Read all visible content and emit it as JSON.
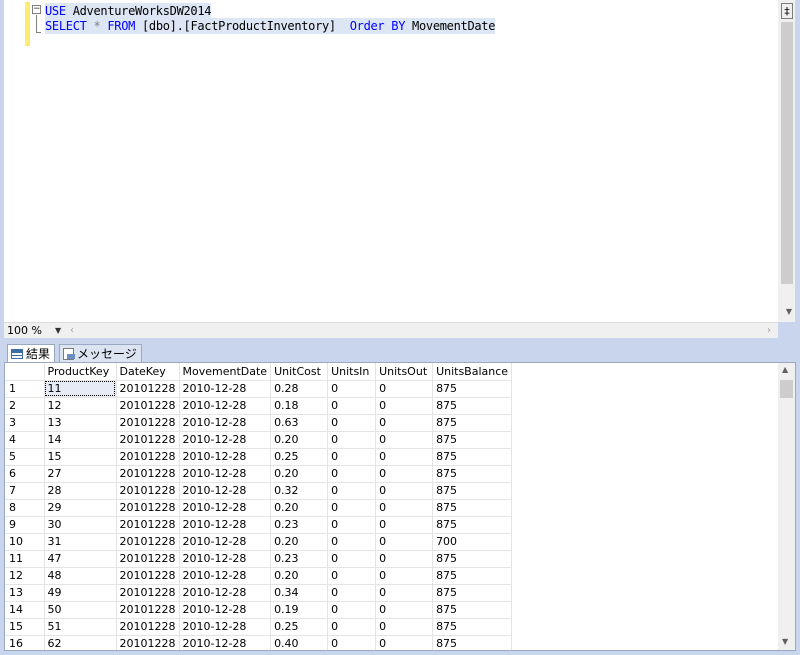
{
  "editor": {
    "fold_glyph": "−",
    "line1": {
      "kw": "USE",
      "rest": " AdventureWorksDW2014"
    },
    "line2": {
      "select": "SELECT",
      "star": " * ",
      "from": "FROM",
      "object": " [dbo].[FactProductInventory]  ",
      "order": "Order BY",
      "column": " MovementDate"
    },
    "split_glyph": "‡"
  },
  "zoom": {
    "value": "100 %"
  },
  "tabs": [
    {
      "label": "結果",
      "icon": "grid-icon"
    },
    {
      "label": "メッセージ",
      "icon": "message-icon"
    }
  ],
  "results": {
    "columns": [
      "",
      "ProductKey",
      "DateKey",
      "MovementDate",
      "UnitCost",
      "UnitsIn",
      "UnitsOut",
      "UnitsBalance"
    ],
    "rows": [
      [
        "1",
        "11",
        "20101228",
        "2010-12-28",
        "0.28",
        "0",
        "0",
        "875"
      ],
      [
        "2",
        "12",
        "20101228",
        "2010-12-28",
        "0.18",
        "0",
        "0",
        "875"
      ],
      [
        "3",
        "13",
        "20101228",
        "2010-12-28",
        "0.63",
        "0",
        "0",
        "875"
      ],
      [
        "4",
        "14",
        "20101228",
        "2010-12-28",
        "0.20",
        "0",
        "0",
        "875"
      ],
      [
        "5",
        "15",
        "20101228",
        "2010-12-28",
        "0.25",
        "0",
        "0",
        "875"
      ],
      [
        "6",
        "27",
        "20101228",
        "2010-12-28",
        "0.20",
        "0",
        "0",
        "875"
      ],
      [
        "7",
        "28",
        "20101228",
        "2010-12-28",
        "0.32",
        "0",
        "0",
        "875"
      ],
      [
        "8",
        "29",
        "20101228",
        "2010-12-28",
        "0.20",
        "0",
        "0",
        "875"
      ],
      [
        "9",
        "30",
        "20101228",
        "2010-12-28",
        "0.23",
        "0",
        "0",
        "875"
      ],
      [
        "10",
        "31",
        "20101228",
        "2010-12-28",
        "0.20",
        "0",
        "0",
        "700"
      ],
      [
        "11",
        "47",
        "20101228",
        "2010-12-28",
        "0.23",
        "0",
        "0",
        "875"
      ],
      [
        "12",
        "48",
        "20101228",
        "2010-12-28",
        "0.20",
        "0",
        "0",
        "875"
      ],
      [
        "13",
        "49",
        "20101228",
        "2010-12-28",
        "0.34",
        "0",
        "0",
        "875"
      ],
      [
        "14",
        "50",
        "20101228",
        "2010-12-28",
        "0.19",
        "0",
        "0",
        "875"
      ],
      [
        "15",
        "51",
        "20101228",
        "2010-12-28",
        "0.25",
        "0",
        "0",
        "875"
      ],
      [
        "16",
        "62",
        "20101228",
        "2010-12-28",
        "0.40",
        "0",
        "0",
        "875"
      ]
    ],
    "selected_cell": [
      0,
      1
    ]
  }
}
